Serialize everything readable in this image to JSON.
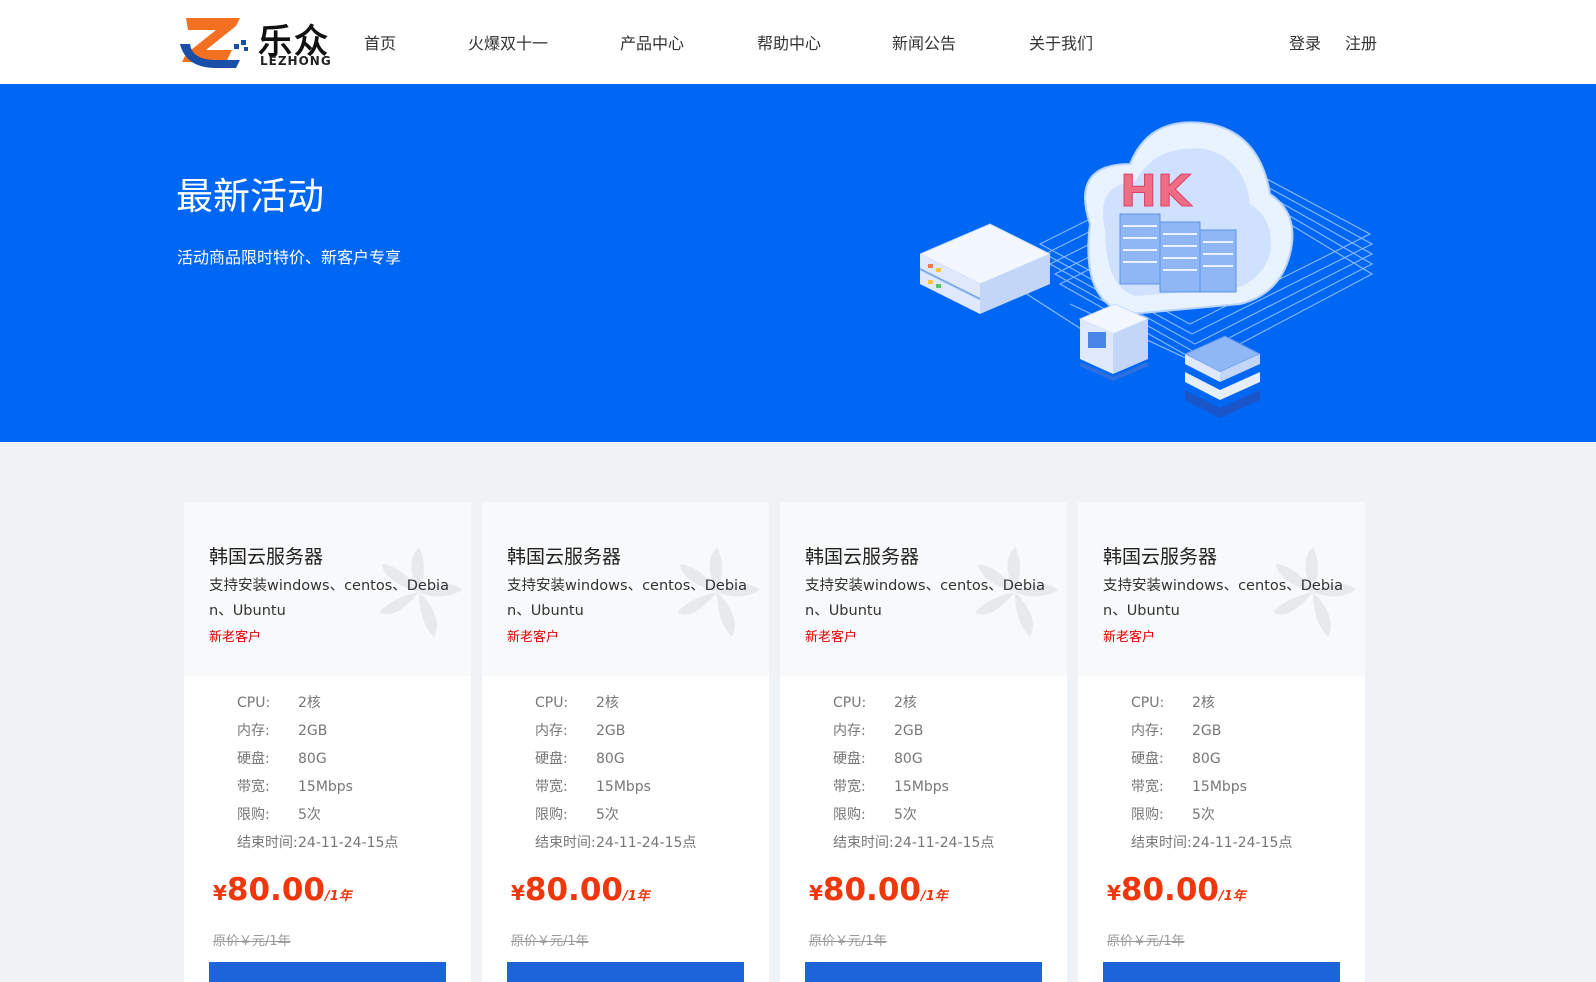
{
  "header": {
    "logo_cn": "乐众",
    "logo_en": "LEZHONG",
    "nav": [
      "首页",
      "火爆双十一",
      "产品中心",
      "帮助中心",
      "新闻公告",
      "关于我们"
    ],
    "login": "登录",
    "register": "注册"
  },
  "hero": {
    "title": "最新活动",
    "subtitle": "活动商品限时特价、新客户专享",
    "art_label": "HK"
  },
  "cards": [
    {
      "title": "韩国云服务器",
      "desc": "支持安装windows、centos、Debian、Ubuntu",
      "tag": "新老客户",
      "specs": [
        {
          "k": "CPU:",
          "v": "2核"
        },
        {
          "k": "内存:",
          "v": "2GB"
        },
        {
          "k": "硬盘:",
          "v": "80G"
        },
        {
          "k": "带宽:",
          "v": "15Mbps"
        },
        {
          "k": "限购:",
          "v": "5次"
        },
        {
          "k": "结束时间:",
          "v": "24-11-24-15点"
        }
      ],
      "currency": "¥",
      "price": "80.00",
      "period": "/1年",
      "original": "原价￥元/1年"
    },
    {
      "title": "韩国云服务器",
      "desc": "支持安装windows、centos、Debian、Ubuntu",
      "tag": "新老客户",
      "specs": [
        {
          "k": "CPU:",
          "v": "2核"
        },
        {
          "k": "内存:",
          "v": "2GB"
        },
        {
          "k": "硬盘:",
          "v": "80G"
        },
        {
          "k": "带宽:",
          "v": "15Mbps"
        },
        {
          "k": "限购:",
          "v": "5次"
        },
        {
          "k": "结束时间:",
          "v": "24-11-24-15点"
        }
      ],
      "currency": "¥",
      "price": "80.00",
      "period": "/1年",
      "original": "原价￥元/1年"
    },
    {
      "title": "韩国云服务器",
      "desc": "支持安装windows、centos、Debian、Ubuntu",
      "tag": "新老客户",
      "specs": [
        {
          "k": "CPU:",
          "v": "2核"
        },
        {
          "k": "内存:",
          "v": "2GB"
        },
        {
          "k": "硬盘:",
          "v": "80G"
        },
        {
          "k": "带宽:",
          "v": "15Mbps"
        },
        {
          "k": "限购:",
          "v": "5次"
        },
        {
          "k": "结束时间:",
          "v": "24-11-24-15点"
        }
      ],
      "currency": "¥",
      "price": "80.00",
      "period": "/1年",
      "original": "原价￥元/1年"
    },
    {
      "title": "韩国云服务器",
      "desc": "支持安装windows、centos、Debian、Ubuntu",
      "tag": "新老客户",
      "specs": [
        {
          "k": "CPU:",
          "v": "2核"
        },
        {
          "k": "内存:",
          "v": "2GB"
        },
        {
          "k": "硬盘:",
          "v": "80G"
        },
        {
          "k": "带宽:",
          "v": "15Mbps"
        },
        {
          "k": "限购:",
          "v": "5次"
        },
        {
          "k": "结束时间:",
          "v": "24-11-24-15点"
        }
      ],
      "currency": "¥",
      "price": "80.00",
      "period": "/1年",
      "original": "原价￥元/1年"
    }
  ],
  "colors": {
    "brand_blue": "#0067f4",
    "price_orange": "#f0360b",
    "tag_red": "#e00000",
    "button_blue": "#1d64d8"
  }
}
